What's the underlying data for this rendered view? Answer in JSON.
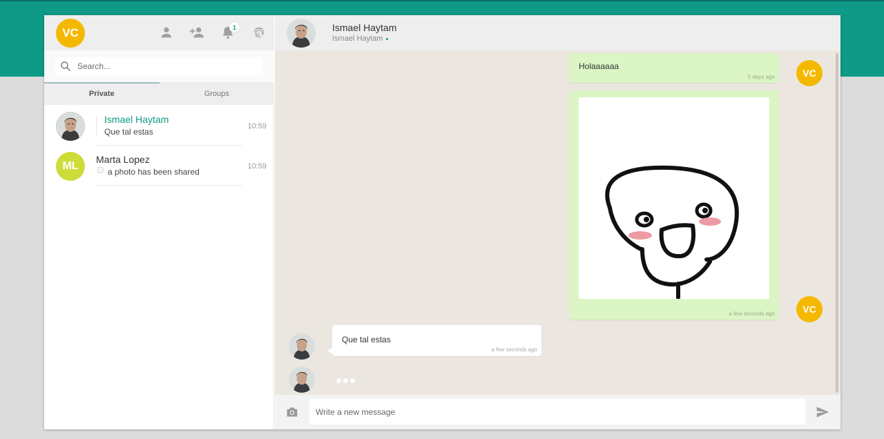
{
  "me": {
    "initials": "VC",
    "color": "#f5b800"
  },
  "header_icons": [
    "person-icon",
    "add-person-icon",
    "bell-icon",
    "fingerprint-icon"
  ],
  "notifications": {
    "count": "1"
  },
  "search": {
    "placeholder": "Search..."
  },
  "tabs": [
    {
      "label": "Private",
      "active": true
    },
    {
      "label": "Groups",
      "active": false
    }
  ],
  "chats": [
    {
      "name": "Ismael Haytam",
      "preview": "Que tal estas",
      "time": "10:59",
      "active": true
    },
    {
      "name": "Marta Lopez",
      "initials": "ML",
      "avatar_color": "#cddc39",
      "preview": "a photo has been shared",
      "time": "10:59",
      "active": false
    }
  ],
  "conversation": {
    "contact_name": "Ismael Haytam",
    "contact_status": "Ismael Haytam"
  },
  "messages": [
    {
      "direction": "out",
      "text": "Holaaaaaa",
      "time": "5 days ago"
    },
    {
      "direction": "out",
      "type": "image",
      "time": "a few seconds ago"
    },
    {
      "direction": "in",
      "text": "Que tal estas",
      "time": "a few seconds ago"
    }
  ],
  "composer": {
    "placeholder": "Write a new message"
  },
  "colors": {
    "accent": "#0e9a87",
    "outgoing_bubble": "#dbf6c4",
    "chat_background": "#ebe7e0"
  }
}
